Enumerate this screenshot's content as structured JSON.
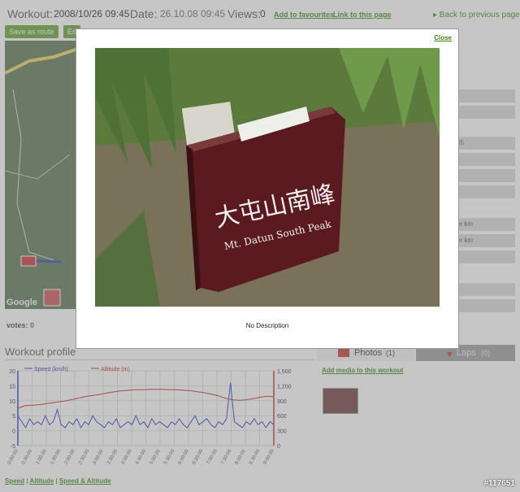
{
  "header": {
    "workout_label": "Workout:",
    "workout_value": "2008/10/26 09:45",
    "date_label": "Date:",
    "date_value": "26.10.08 09:45",
    "views_label": "Views:",
    "views_value": "0",
    "add_favourites": "Add to favourites",
    "link_page": "Link to this page",
    "back": "▸ Back to previous page"
  },
  "toolbar": {
    "save_route": "Save as route",
    "ed": "Ed"
  },
  "map": {
    "google": "Google"
  },
  "votes": {
    "label": "votes:",
    "value": "0"
  },
  "rightcol": {
    "rows": [
      "",
      "",
      "45",
      "",
      "",
      "",
      "er km",
      "er km",
      "",
      "",
      ""
    ]
  },
  "profile": {
    "title": "Workout profile",
    "links": {
      "speed": "Speed",
      "altitude": "Altitude",
      "speed_altitude": "Speed & Altitude",
      "sep": " | "
    }
  },
  "media": {
    "photos_label": "Photos",
    "photos_count": "(1)",
    "laps_label": "Laps",
    "laps_count": "(0)",
    "add_media": "Add media to this workout"
  },
  "modal": {
    "close": "Close",
    "sign_cn": "大屯山南峰",
    "sign_en": "Mt. Datun South Peak",
    "description": "No Description"
  },
  "watermark": "#117651",
  "chart_data": {
    "type": "line",
    "legend": [
      "Speed (km/h)",
      "Altitude (m)"
    ],
    "y_left_ticks": [
      "20",
      "15",
      "10",
      "5",
      "0",
      "-5"
    ],
    "y_right_ticks": [
      "1,500",
      "1,200",
      "900",
      "600",
      "300",
      "0"
    ],
    "ylim_left": [
      -5,
      20
    ],
    "ylim_right": [
      0,
      1500
    ],
    "x_ticks": [
      "0:00:00",
      "0:30:00",
      "1:00:00",
      "1:30:00",
      "2:00:00",
      "2:30:00",
      "3:00:00",
      "3:30:00",
      "4:00:00",
      "4:30:00",
      "5:00:00",
      "5:30:00",
      "6:00:00",
      "6:30:00",
      "7:00:00",
      "7:30:00",
      "8:00:00",
      "8:30:00",
      "9:00:00"
    ],
    "series": [
      {
        "name": "Speed (km/h)",
        "axis": "left",
        "color": "#2233cc",
        "values": [
          5,
          3,
          1,
          4,
          2,
          3,
          2,
          5,
          2,
          3,
          7,
          2,
          1,
          3,
          2,
          4,
          1,
          3,
          2,
          5,
          3,
          2,
          1,
          3,
          2,
          4,
          1,
          2,
          3,
          2,
          5,
          2,
          3,
          1,
          4,
          2,
          3,
          2,
          1,
          3,
          2,
          4,
          2,
          1,
          3,
          5,
          2,
          3,
          4,
          2,
          1,
          3,
          2,
          4,
          16,
          3,
          2,
          1,
          3,
          2,
          4,
          2,
          3,
          1,
          3,
          2
        ]
      },
      {
        "name": "Altitude (m)",
        "axis": "right",
        "color": "#cc2222",
        "values": [
          750,
          800,
          810,
          820,
          840,
          860,
          880,
          900,
          930,
          960,
          990,
          1010,
          1030,
          1060,
          1080,
          1100,
          1110,
          1120,
          1120,
          1130,
          1130,
          1130,
          1120,
          1120,
          1110,
          1100,
          1080,
          1060,
          1030,
          1000,
          950,
          920,
          910,
          920,
          940,
          970,
          990,
          980
        ]
      }
    ]
  }
}
